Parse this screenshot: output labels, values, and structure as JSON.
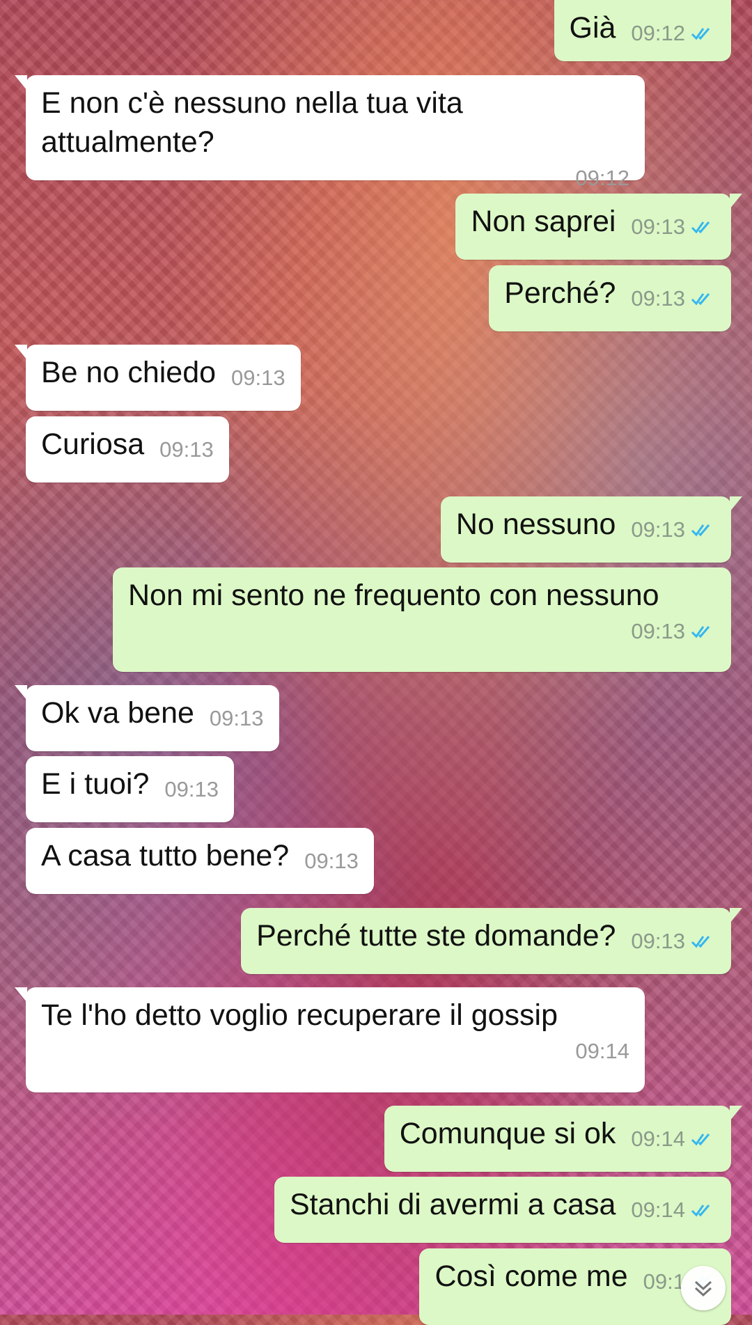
{
  "chat": {
    "messages": [
      {
        "id": "m1",
        "dir": "out",
        "text": "Già",
        "time": "09:12",
        "status": "read"
      },
      {
        "id": "m2",
        "dir": "in",
        "text": "E non c'è nessuno nella tua vita attualmente?",
        "time": "09:12"
      },
      {
        "id": "m3",
        "dir": "out",
        "text": "Non saprei",
        "time": "09:13",
        "status": "read"
      },
      {
        "id": "m4",
        "dir": "out",
        "text": "Perché?",
        "time": "09:13",
        "status": "read"
      },
      {
        "id": "m5",
        "dir": "in",
        "text": "Be no chiedo",
        "time": "09:13"
      },
      {
        "id": "m6",
        "dir": "in",
        "text": "Curiosa",
        "time": "09:13"
      },
      {
        "id": "m7",
        "dir": "out",
        "text": "No nessuno",
        "time": "09:13",
        "status": "read"
      },
      {
        "id": "m8",
        "dir": "out",
        "text": "Non mi sento ne frequento con nessuno",
        "time": "09:13",
        "status": "read"
      },
      {
        "id": "m9",
        "dir": "in",
        "text": "Ok va bene",
        "time": "09:13"
      },
      {
        "id": "m10",
        "dir": "in",
        "text": "E i tuoi?",
        "time": "09:13"
      },
      {
        "id": "m11",
        "dir": "in",
        "text": "A casa tutto bene?",
        "time": "09:13"
      },
      {
        "id": "m12",
        "dir": "out",
        "text": "Perché tutte ste domande?",
        "time": "09:13",
        "status": "read"
      },
      {
        "id": "m13",
        "dir": "in",
        "text": "Te l'ho detto voglio recuperare il gossip",
        "time": "09:14"
      },
      {
        "id": "m14",
        "dir": "out",
        "text": "Comunque si ok",
        "time": "09:14",
        "status": "read"
      },
      {
        "id": "m15",
        "dir": "out",
        "text": "Stanchi di avermi a casa",
        "time": "09:14",
        "status": "read"
      },
      {
        "id": "m16",
        "dir": "out",
        "text": "Così come me",
        "time": "09:1",
        "status": "read"
      }
    ]
  },
  "icons": {
    "read_ticks": "double-check-icon",
    "scroll_down": "chevron-double-down-icon"
  },
  "colors": {
    "outgoing_bubble": "#dcf8c6",
    "incoming_bubble": "#ffffff",
    "read_ticks": "#34b7f1"
  }
}
